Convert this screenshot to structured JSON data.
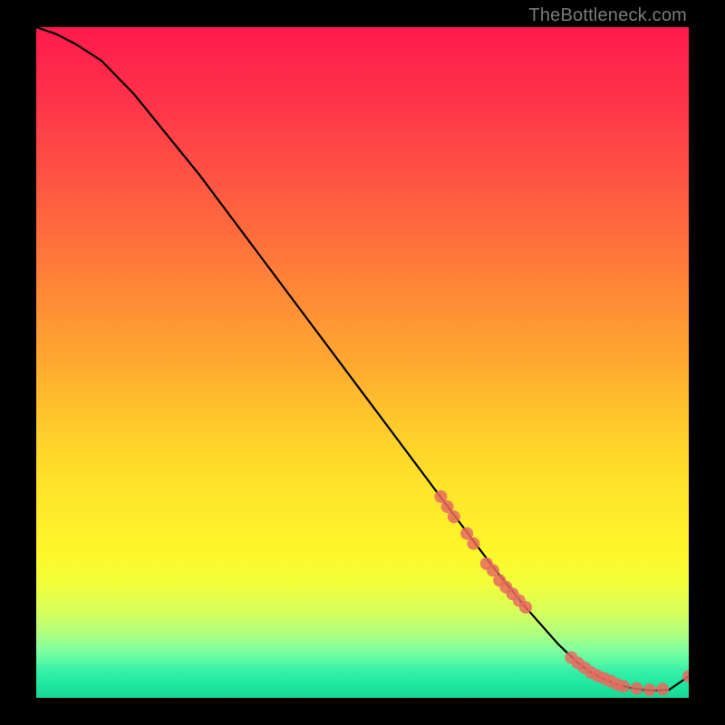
{
  "watermark": "TheBottleneck.com",
  "chart_data": {
    "type": "line",
    "title": "",
    "xlabel": "",
    "ylabel": "",
    "xlim": [
      0,
      100
    ],
    "ylim": [
      0,
      100
    ],
    "grid": false,
    "legend": false,
    "series": [
      {
        "name": "curve",
        "color": "#000000",
        "x": [
          0,
          3,
          6,
          10,
          15,
          20,
          25,
          30,
          35,
          40,
          45,
          50,
          55,
          60,
          65,
          70,
          75,
          80,
          83,
          85,
          87,
          89,
          91,
          93,
          95,
          97,
          100
        ],
        "y": [
          100,
          99,
          97.5,
          95,
          90,
          84,
          78,
          71.5,
          65,
          58.5,
          52,
          45.5,
          39,
          32.5,
          26,
          19.5,
          13.5,
          8,
          5.2,
          3.8,
          2.8,
          2.0,
          1.5,
          1.2,
          1.1,
          1.2,
          3.2
        ]
      },
      {
        "name": "markers",
        "type": "scatter",
        "color": "#e86a5f",
        "points": [
          {
            "x": 62,
            "y": 30
          },
          {
            "x": 63,
            "y": 28.5
          },
          {
            "x": 64,
            "y": 27
          },
          {
            "x": 66,
            "y": 24.5
          },
          {
            "x": 67,
            "y": 23
          },
          {
            "x": 69,
            "y": 20
          },
          {
            "x": 70,
            "y": 19
          },
          {
            "x": 71,
            "y": 17.5
          },
          {
            "x": 72,
            "y": 16.5
          },
          {
            "x": 73,
            "y": 15.5
          },
          {
            "x": 74,
            "y": 14.5
          },
          {
            "x": 75,
            "y": 13.5
          },
          {
            "x": 82,
            "y": 6
          },
          {
            "x": 83,
            "y": 5.2
          },
          {
            "x": 84,
            "y": 4.5
          },
          {
            "x": 85,
            "y": 3.8
          },
          {
            "x": 86,
            "y": 3.3
          },
          {
            "x": 87,
            "y": 2.9
          },
          {
            "x": 88,
            "y": 2.5
          },
          {
            "x": 89,
            "y": 2.0
          },
          {
            "x": 90,
            "y": 1.7
          },
          {
            "x": 92,
            "y": 1.4
          },
          {
            "x": 94,
            "y": 1.2
          },
          {
            "x": 96,
            "y": 1.3
          },
          {
            "x": 100,
            "y": 3.2
          }
        ]
      }
    ]
  }
}
